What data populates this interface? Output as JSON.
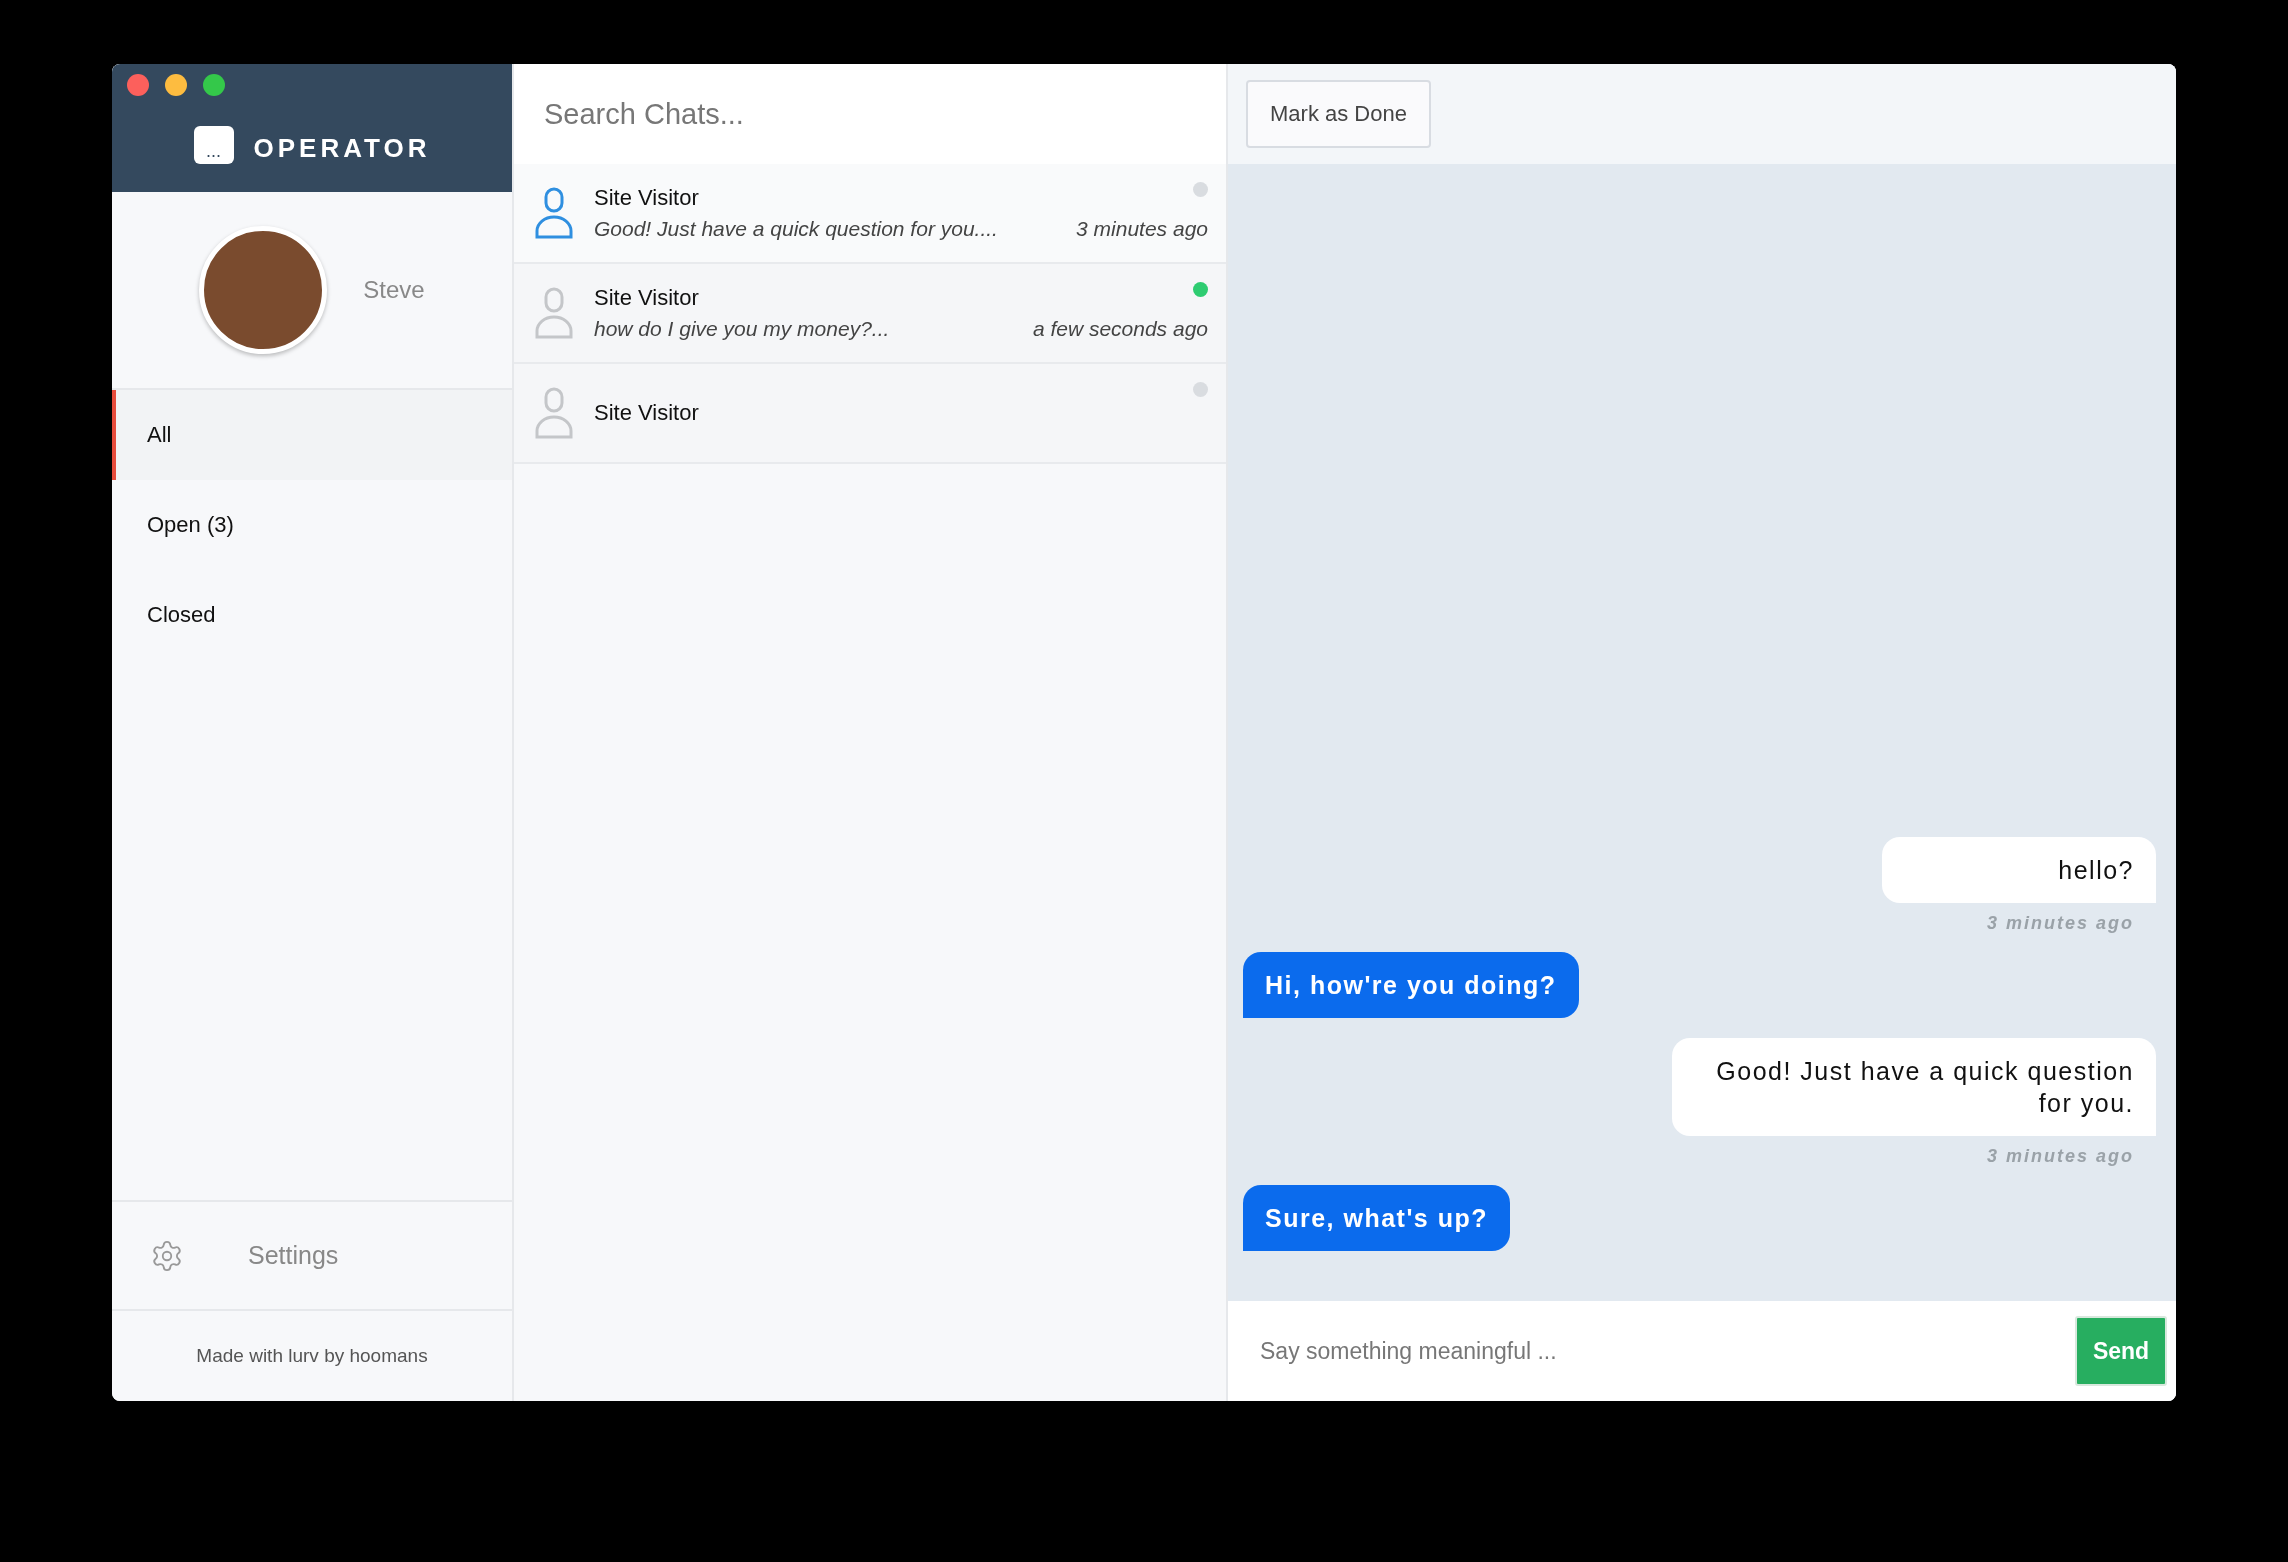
{
  "app": {
    "logo_glyph": "...",
    "title": "OPERATOR"
  },
  "profile": {
    "name": "Steve"
  },
  "nav": [
    {
      "label": "All",
      "selected": true
    },
    {
      "label": "Open (3)",
      "selected": false
    },
    {
      "label": "Closed",
      "selected": false
    }
  ],
  "settings": {
    "label": "Settings"
  },
  "footer": "Made with lurv by hoomans",
  "search": {
    "placeholder": "Search Chats..."
  },
  "chats": [
    {
      "name": "Site Visitor",
      "preview": "Good! Just have a quick question for you....",
      "time": "3 minutes ago",
      "selected": true,
      "online": false
    },
    {
      "name": "Site Visitor",
      "preview": "how do I give you my money?...",
      "time": "a few seconds ago",
      "selected": false,
      "online": true
    },
    {
      "name": "Site Visitor",
      "selected": false,
      "online": false
    }
  ],
  "toolbar": {
    "button": "Mark as Done"
  },
  "messages": [
    {
      "kind": "incoming",
      "text": "hello?",
      "time": "3 minutes ago"
    },
    {
      "kind": "outgoing",
      "text": "Hi, how're you doing?"
    },
    {
      "kind": "incoming",
      "text": "Good! Just have a quick question for you.",
      "time": "3 minutes ago"
    },
    {
      "kind": "outgoing",
      "text": "Sure, what's up?"
    }
  ],
  "composer": {
    "placeholder": "Say something meaningful ...",
    "button": "Send"
  }
}
